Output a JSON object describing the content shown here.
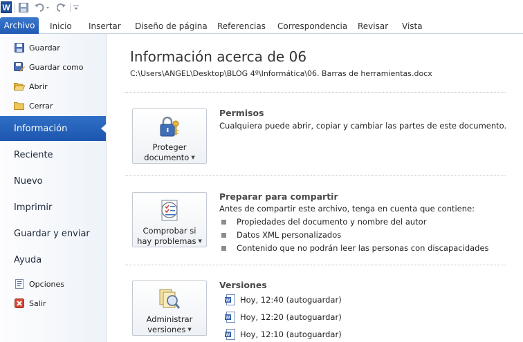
{
  "qat": {
    "app_icon_letter": "W",
    "items": [
      "save-icon",
      "undo-icon",
      "redo-icon",
      "customize-qat-icon"
    ]
  },
  "ribbon": {
    "tabs": [
      {
        "label": "Archivo",
        "active": true
      },
      {
        "label": "Inicio"
      },
      {
        "label": "Insertar"
      },
      {
        "label": "Diseño de página"
      },
      {
        "label": "Referencias"
      },
      {
        "label": "Correspondencia"
      },
      {
        "label": "Revisar"
      },
      {
        "label": "Vista"
      }
    ]
  },
  "nav": {
    "commands": [
      {
        "label": "Guardar",
        "icon": "save-icon"
      },
      {
        "label": "Guardar como",
        "icon": "save-as-icon"
      },
      {
        "label": "Abrir",
        "icon": "open-folder-icon"
      },
      {
        "label": "Cerrar",
        "icon": "close-folder-icon"
      }
    ],
    "tabs": [
      {
        "label": "Información",
        "selected": true
      },
      {
        "label": "Reciente"
      },
      {
        "label": "Nuevo"
      },
      {
        "label": "Imprimir"
      },
      {
        "label": "Guardar y enviar"
      },
      {
        "label": "Ayuda"
      }
    ],
    "bottom": [
      {
        "label": "Opciones",
        "icon": "options-icon"
      },
      {
        "label": "Salir",
        "icon": "exit-icon"
      }
    ]
  },
  "info": {
    "title": "Información acerca de 06",
    "path": "C:\\Users\\ANGEL\\Desktop\\BLOG 4º\\Informática\\06. Barras de herramientas.docx",
    "permissions": {
      "button_line1": "Proteger",
      "button_line2": "documento",
      "title": "Permisos",
      "desc": "Cualquiera puede abrir, copiar y cambiar las partes de este documento."
    },
    "prepare": {
      "button_line1": "Comprobar si",
      "button_line2": "hay problemas",
      "title": "Preparar para compartir",
      "desc": "Antes de compartir este archivo, tenga en cuenta que contiene:",
      "items": [
        "Propiedades del documento y nombre del autor",
        "Datos XML personalizados",
        "Contenido que no podrán leer las personas con discapacidades"
      ]
    },
    "versions": {
      "button_line1": "Administrar",
      "button_line2": "versiones",
      "title": "Versiones",
      "items": [
        "Hoy, 12:40 (autoguardar)",
        "Hoy, 12:20 (autoguardar)",
        "Hoy, 12:10 (autoguardar)"
      ]
    }
  },
  "colors": {
    "accent": "#2a65bf",
    "nav_bg": "#eef3f9"
  }
}
